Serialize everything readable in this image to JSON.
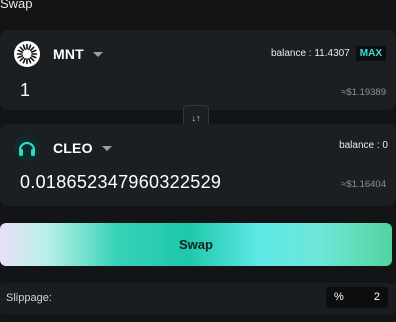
{
  "header": {
    "title": "Swap"
  },
  "from": {
    "token": "MNT",
    "token_icon": "mantle-sun-icon",
    "balance": "balance : 11.4307",
    "max_label": "MAX",
    "amount": "1",
    "usd_value": "≈$1.19389"
  },
  "switch": {
    "glyph": "↓↑",
    "icon": "switch-arrows-icon"
  },
  "to": {
    "token": "CLEO",
    "token_icon": "cleo-headphones-icon",
    "balance": "balance : 0",
    "amount": "0.018652347960322529",
    "usd_value": "≈$1.16404"
  },
  "action": {
    "swap_label": "Swap"
  },
  "slippage": {
    "label": "Slippage:",
    "unit": "%",
    "value": "2"
  },
  "colors": {
    "background": "#121416",
    "panel": "#1c1f22",
    "accent": "#38e0e0",
    "swap_gradient_mid": "#1fc8aa"
  }
}
